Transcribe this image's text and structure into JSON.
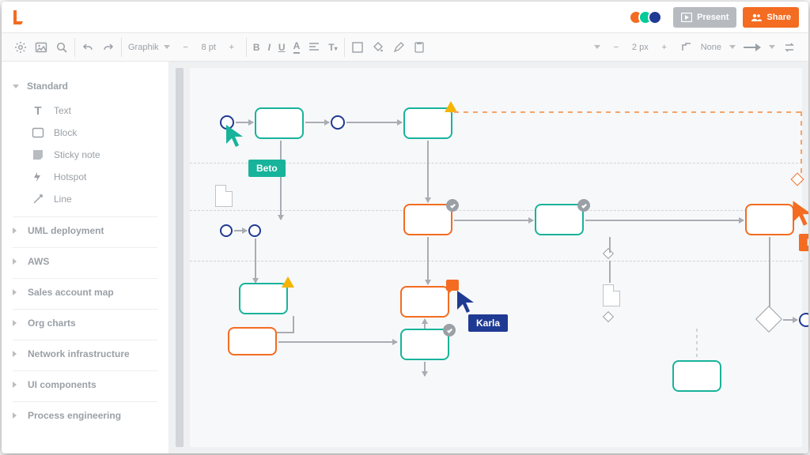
{
  "toolbar": {
    "present_label": "Present",
    "share_label": "Share",
    "font_name": "Graphik",
    "font_size": "8 pt",
    "stroke_width": "2 px",
    "line_end_label": "None"
  },
  "sidebar": {
    "categories": [
      {
        "label": "Standard",
        "expanded": true,
        "items": [
          {
            "label": "Text"
          },
          {
            "label": "Block"
          },
          {
            "label": "Sticky note"
          },
          {
            "label": "Hotspot"
          },
          {
            "label": "Line"
          }
        ]
      },
      {
        "label": "UML deployment",
        "expanded": false
      },
      {
        "label": "AWS",
        "expanded": false
      },
      {
        "label": "Sales account map",
        "expanded": false
      },
      {
        "label": "Org charts",
        "expanded": false
      },
      {
        "label": "Network infrastructure",
        "expanded": false
      },
      {
        "label": "UI components",
        "expanded": false
      },
      {
        "label": "Process engineering",
        "expanded": false
      }
    ]
  },
  "collaborators": {
    "beto": "Beto",
    "karla": "Karla",
    "dax": "Dax"
  },
  "colors": {
    "teal": "#18b39b",
    "orange": "#f36c21",
    "navy": "#1f3a93",
    "gold": "#f5b400"
  }
}
